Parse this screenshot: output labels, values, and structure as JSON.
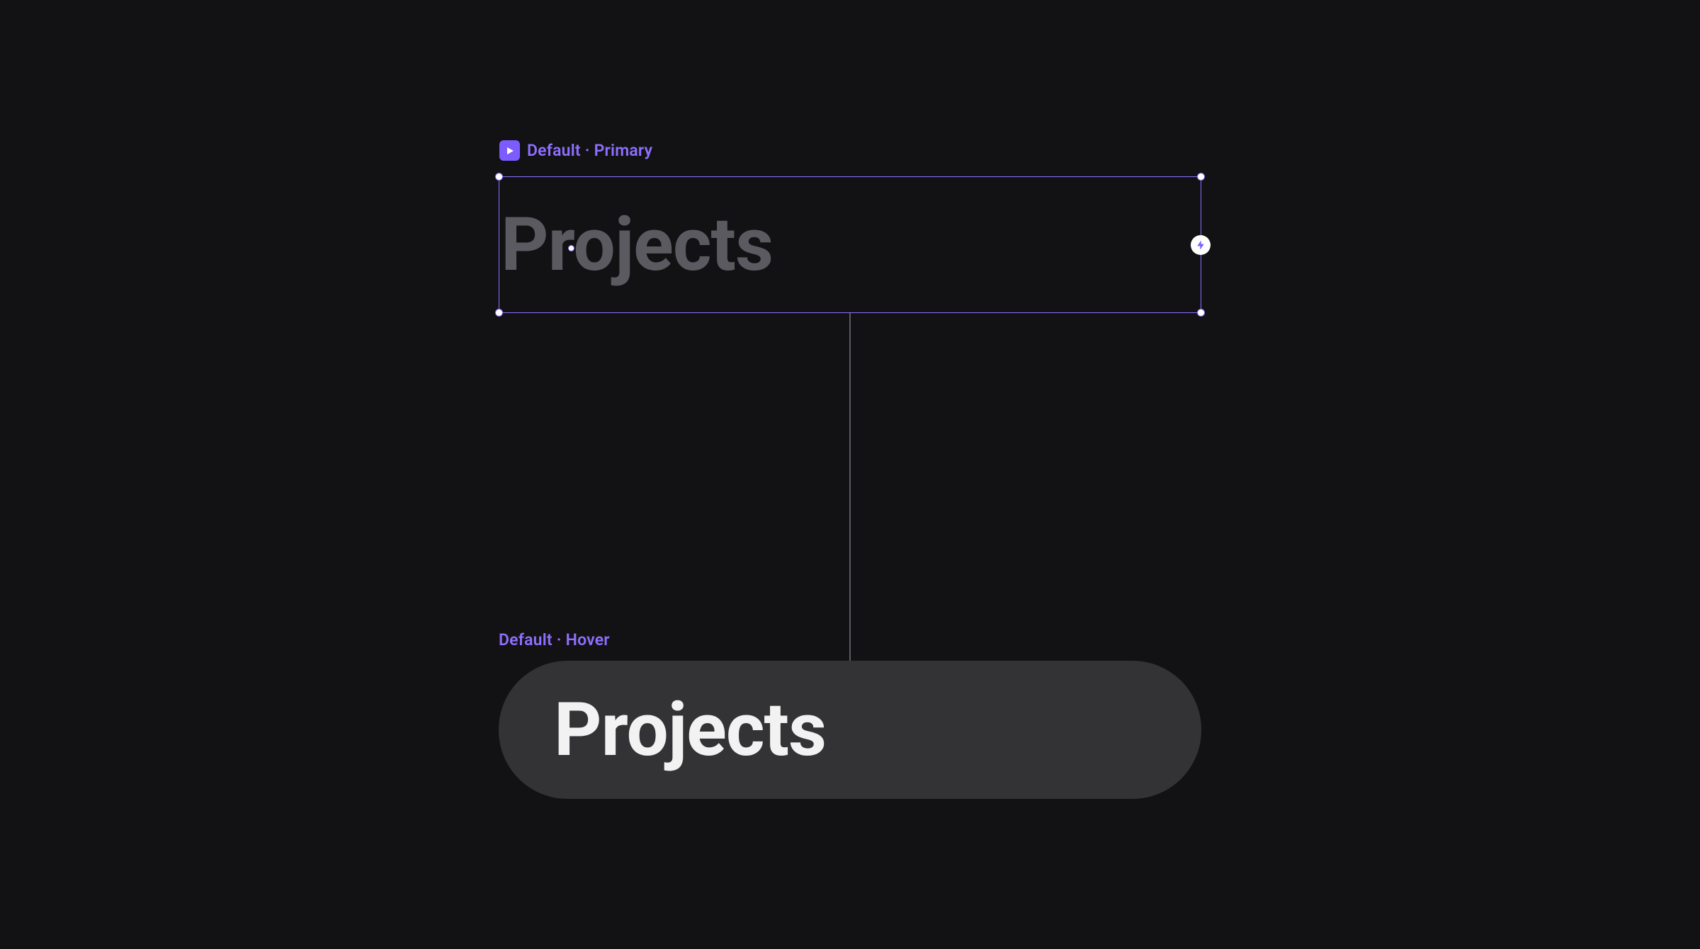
{
  "variants": {
    "primary": {
      "label": "Default · Primary",
      "content": "Projects"
    },
    "hover": {
      "label": "Default · Hover",
      "content": "Projects"
    }
  },
  "colors": {
    "accent": "#8e6fff",
    "background": "#121214",
    "hoverFill": "#333336",
    "primaryTextMuted": "#5a5a60",
    "hoverText": "#f2f2f2"
  }
}
